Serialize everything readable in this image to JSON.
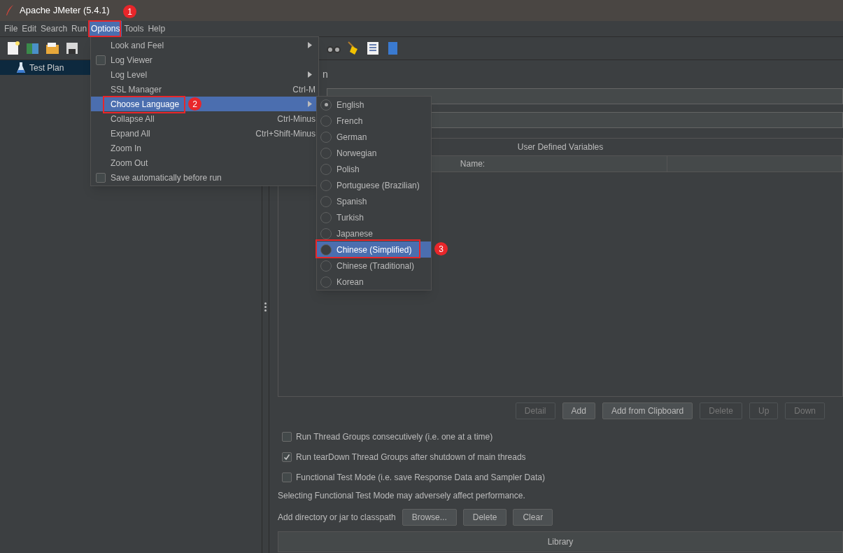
{
  "window": {
    "title": "Apache JMeter (5.4.1)"
  },
  "menu_bar": [
    {
      "label": "File",
      "selected": false
    },
    {
      "label": "Edit",
      "selected": false
    },
    {
      "label": "Search",
      "selected": false
    },
    {
      "label": "Run",
      "selected": false
    },
    {
      "label": "Options",
      "selected": true
    },
    {
      "label": "Tools",
      "selected": false
    },
    {
      "label": "Help",
      "selected": false
    }
  ],
  "tree": [
    {
      "label": "Test Plan",
      "selected": true
    }
  ],
  "title_fragment": "n",
  "options_menu": [
    {
      "kind": "submenu",
      "label": "Look and Feel",
      "selected": false
    },
    {
      "kind": "check",
      "label": "Log Viewer",
      "checked": false,
      "selected": false
    },
    {
      "kind": "submenu",
      "label": "Log Level",
      "selected": false
    },
    {
      "kind": "item",
      "label": "SSL Manager",
      "shortcut": "Ctrl-M",
      "selected": false
    },
    {
      "kind": "submenu",
      "label": "Choose Language",
      "selected": true
    },
    {
      "kind": "item",
      "label": "Collapse All",
      "shortcut": "Ctrl-Minus",
      "selected": false
    },
    {
      "kind": "item",
      "label": "Expand All",
      "shortcut": "Ctrl+Shift-Minus",
      "selected": false
    },
    {
      "kind": "item",
      "label": "Zoom In",
      "selected": false
    },
    {
      "kind": "item",
      "label": "Zoom Out",
      "selected": false
    },
    {
      "kind": "check",
      "label": "Save automatically before run",
      "checked": false,
      "selected": false
    }
  ],
  "language_menu": [
    {
      "label": "English",
      "checked": true,
      "selected": false
    },
    {
      "label": "French",
      "checked": false,
      "selected": false
    },
    {
      "label": "German",
      "checked": false,
      "selected": false
    },
    {
      "label": "Norwegian",
      "checked": false,
      "selected": false
    },
    {
      "label": "Polish",
      "checked": false,
      "selected": false
    },
    {
      "label": "Portuguese (Brazilian)",
      "checked": false,
      "selected": false
    },
    {
      "label": "Spanish",
      "checked": false,
      "selected": false
    },
    {
      "label": "Turkish",
      "checked": false,
      "selected": false
    },
    {
      "label": "Japanese",
      "checked": false,
      "selected": false
    },
    {
      "label": "Chinese (Simplified)",
      "checked": false,
      "selected": true
    },
    {
      "label": "Chinese (Traditional)",
      "checked": false,
      "selected": false
    },
    {
      "label": "Korean",
      "checked": false,
      "selected": false
    }
  ],
  "annotations": [
    {
      "label": "1"
    },
    {
      "label": "2"
    },
    {
      "label": "3"
    }
  ],
  "variables_table": {
    "title": "User Defined Variables",
    "columns": [
      "Name:",
      ""
    ]
  },
  "table_buttons": [
    {
      "label": "Detail",
      "disabled": true
    },
    {
      "label": "Add",
      "disabled": false
    },
    {
      "label": "Add from Clipboard",
      "disabled": false
    },
    {
      "label": "Delete",
      "disabled": true
    },
    {
      "label": "Up",
      "disabled": true
    },
    {
      "label": "Down",
      "disabled": true
    }
  ],
  "options": [
    {
      "label": "Run Thread Groups consecutively (i.e. one at a time)",
      "checked": false
    },
    {
      "label": "Run tearDown Thread Groups after shutdown of main threads",
      "checked": true
    },
    {
      "label": "Functional Test Mode (i.e. save Response Data and Sampler Data)",
      "checked": false
    }
  ],
  "warning": "Selecting Functional Test Mode may adversely affect performance.",
  "classpath": {
    "label": "Add directory or jar to classpath",
    "buttons": [
      "Browse...",
      "Delete",
      "Clear"
    ]
  },
  "library_table": {
    "columns": [
      "Library"
    ]
  }
}
